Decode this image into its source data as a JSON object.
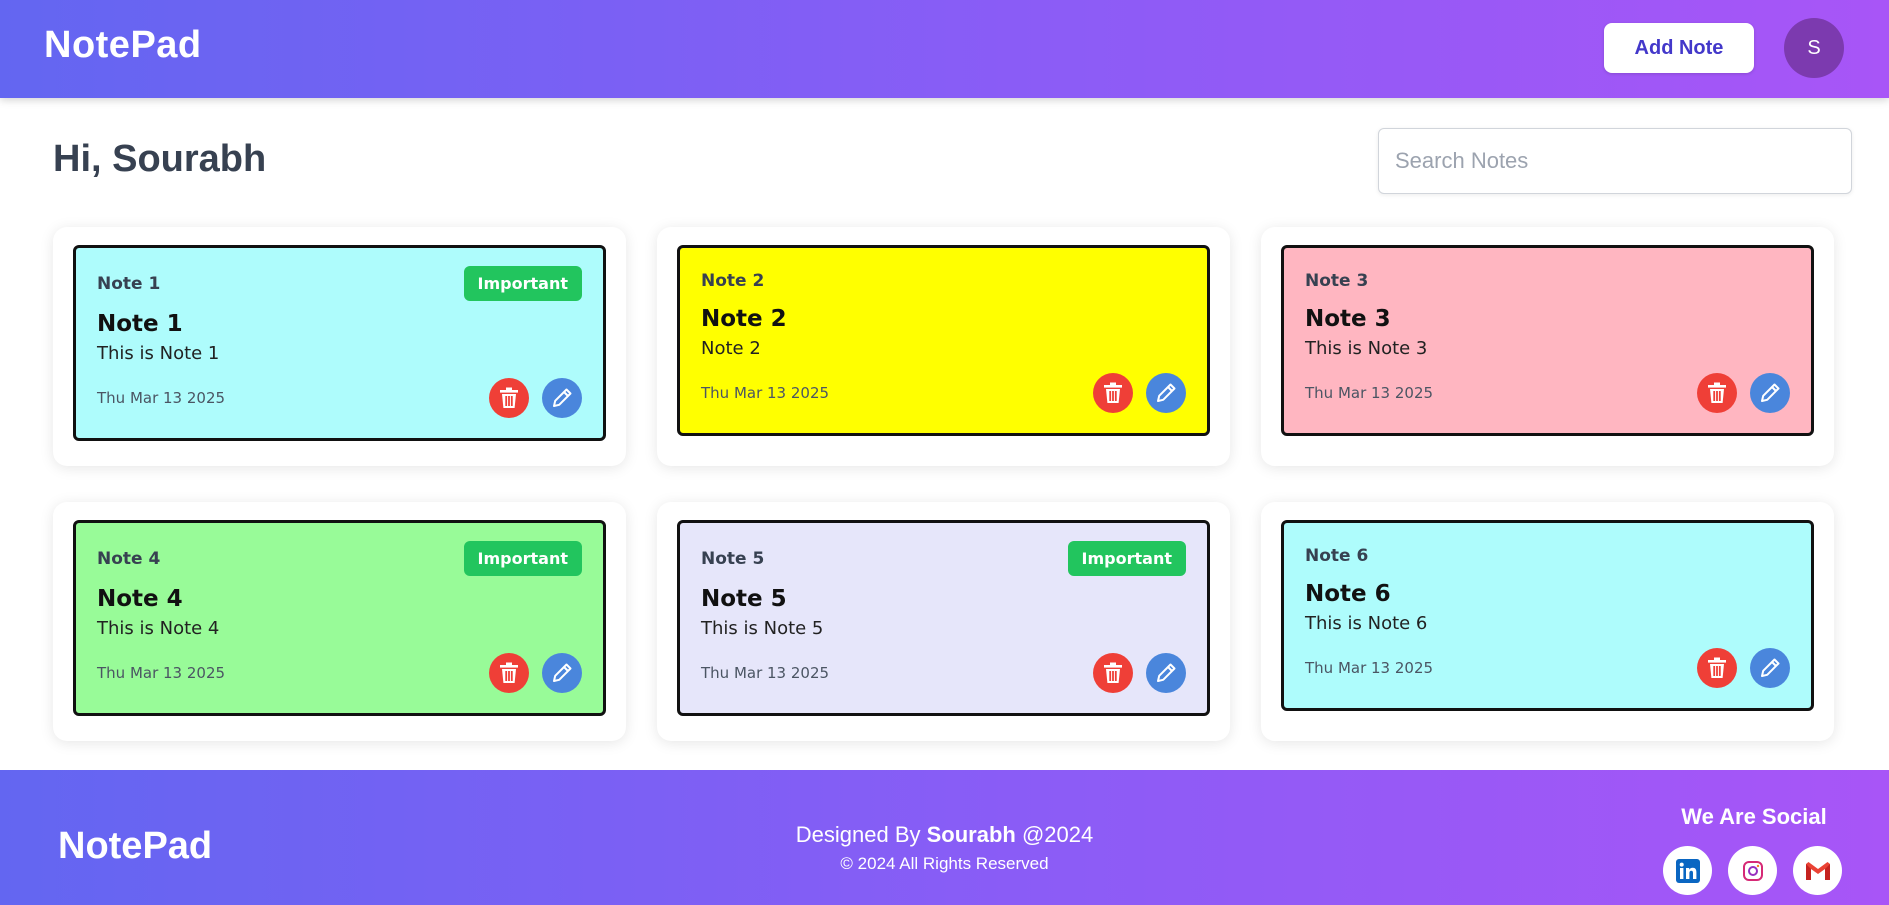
{
  "header": {
    "brand": "NotePad",
    "add_note_label": "Add Note",
    "avatar_initial": "S"
  },
  "main": {
    "greeting": "Hi, Sourabh",
    "search_placeholder": "Search Notes",
    "search_value": ""
  },
  "colors": {
    "header_gradient_start": "#6366f1",
    "header_gradient_end": "#a855f7",
    "important_badge": "#22c55e",
    "delete_button": "#ef3f37",
    "edit_button": "#4a86dc"
  },
  "notes": [
    {
      "label": "Note 1",
      "title": "Note 1",
      "body": "This is Note 1",
      "date": "Thu Mar 13 2025",
      "important": true,
      "badge": "Important",
      "color": "#aefcfc"
    },
    {
      "label": "Note 2",
      "title": "Note 2",
      "body": "Note 2",
      "date": "Thu Mar 13 2025",
      "important": false,
      "badge": "",
      "color": "#ffff00"
    },
    {
      "label": "Note 3",
      "title": "Note 3",
      "body": "This is Note 3",
      "date": "Thu Mar 13 2025",
      "important": false,
      "badge": "",
      "color": "#ffb6c1"
    },
    {
      "label": "Note 4",
      "title": "Note 4",
      "body": "This is Note 4",
      "date": "Thu Mar 13 2025",
      "important": true,
      "badge": "Important",
      "color": "#98fb98"
    },
    {
      "label": "Note 5",
      "title": "Note 5",
      "body": "This is Note 5",
      "date": "Thu Mar 13 2025",
      "important": true,
      "badge": "Important",
      "color": "#e6e6fa"
    },
    {
      "label": "Note 6",
      "title": "Note 6",
      "body": "This is Note 6",
      "date": "Thu Mar 13 2025",
      "important": false,
      "badge": "",
      "color": "#aefcfc"
    }
  ],
  "footer": {
    "brand": "NotePad",
    "designed_prefix": "Designed By ",
    "designer": "Sourabh",
    "designed_suffix": " @2024",
    "rights": "© 2024 All Rights Reserved",
    "social_title": "We Are Social",
    "socials": [
      {
        "icon": "linkedin-icon"
      },
      {
        "icon": "instagram-icon"
      },
      {
        "icon": "gmail-icon"
      }
    ]
  }
}
